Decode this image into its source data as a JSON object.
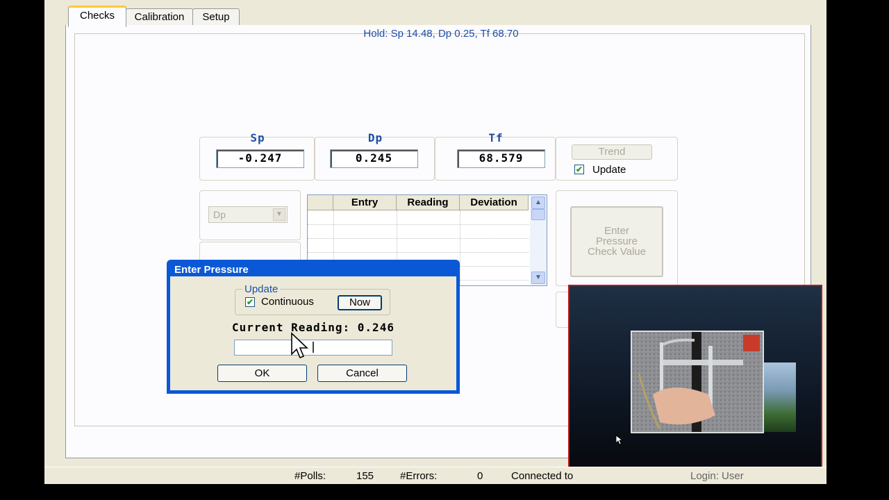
{
  "tabs": [
    "Checks",
    "Calibration",
    "Setup"
  ],
  "hold_text": "Hold: Sp 14.48, Dp 0.25, Tf 68.70",
  "readings": {
    "sp": {
      "label": "Sp",
      "value": "-0.247"
    },
    "dp": {
      "label": "Dp",
      "value": "0.245"
    },
    "tf": {
      "label": "Tf",
      "value": "68.579"
    }
  },
  "trend": {
    "button": "Trend",
    "update_label": "Update",
    "update_checked": true
  },
  "check_select": {
    "value": "Dp"
  },
  "grid": {
    "columns": [
      "Entry",
      "Reading",
      "Deviation"
    ],
    "rows": []
  },
  "enter_check_button": {
    "line1": "Enter",
    "line2": "Pressure",
    "line3": "Check Value"
  },
  "dialog": {
    "title": "Enter Pressure",
    "group_label": "Update",
    "continuous_label": "Continuous",
    "continuous_checked": true,
    "now_button": "Now",
    "current_reading": "Current Reading: 0.246",
    "input_value": "",
    "ok": "OK",
    "cancel": "Cancel"
  },
  "status": {
    "polls_label": "#Polls:",
    "polls_value": "155",
    "errors_label": "#Errors:",
    "errors_value": "0",
    "connection": "Connected to",
    "login": "Login: User"
  },
  "colors": {
    "accent": "#1f4ea6",
    "titlebar": "#0a58d6",
    "overlay_border": "#b81a1a"
  }
}
